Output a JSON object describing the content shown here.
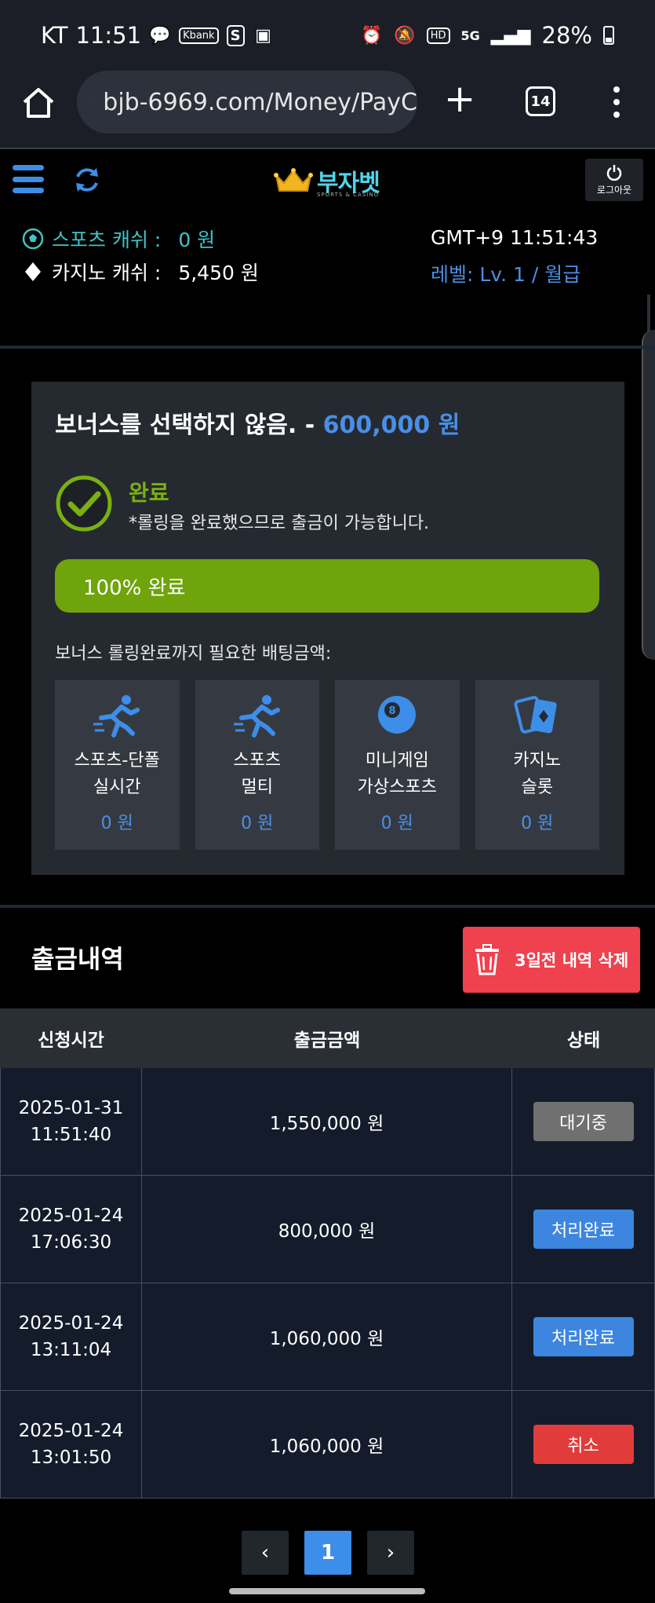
{
  "status_bar": {
    "carrier": "KT",
    "time": "11:51",
    "battery": "28%",
    "icons": [
      "chat-icon",
      "kbank-icon",
      "s-icon",
      "gallery-icon",
      "alarm-icon",
      "mute-icon",
      "hd-icon",
      "5g-icon",
      "signal-icon",
      "battery-icon"
    ],
    "kbank_label": "Kbank",
    "hd_label": "HD",
    "fiveg_label": "5G"
  },
  "browser": {
    "url": "bjb-6969.com/Money/PayC",
    "tab_count": "14"
  },
  "header": {
    "brand": "부자벳",
    "brand_sub": "SPORTS & CASINO",
    "logout_label": "로그아웃"
  },
  "account": {
    "sports_label": "스포츠 캐쉬 :",
    "sports_value": "0 원",
    "casino_label": "카지노 캐쉬 :",
    "casino_value": "5,450 원",
    "clock": "GMT+9 11:51:43",
    "level": "레벨: Lv. 1 / 월급"
  },
  "bonus": {
    "title": "보너스를 선택하지 않음. - ",
    "amount": "600,000 원",
    "status": "완료",
    "status_desc": "*롤링을 완료했으므로 출금이 가능합니다.",
    "progress_text": "100% 완료",
    "progress": 1.0,
    "need_label": "보너스 롤링완료까지 필요한 배팅금액:",
    "cards": [
      {
        "line1": "스포츠-단폴",
        "line2": "실시간",
        "value": "0 원",
        "icon": "runner-icon"
      },
      {
        "line1": "스포츠",
        "line2": "멀티",
        "value": "0 원",
        "icon": "runner-icon"
      },
      {
        "line1": "미니게임",
        "line2": "가상스포츠",
        "value": "0 원",
        "icon": "billiard-ball-icon"
      },
      {
        "line1": "카지노",
        "line2": "슬롯",
        "value": "0 원",
        "icon": "cards-icon"
      }
    ]
  },
  "withdraw": {
    "title": "출금내역",
    "delete_label": "3일전 내역 삭제",
    "columns": [
      "신청시간",
      "출금금액",
      "상태"
    ],
    "rows": [
      {
        "date": "2025-01-31",
        "time": "11:51:40",
        "amount": "1,550,000 원",
        "status": "대기중",
        "color": "#707070"
      },
      {
        "date": "2025-01-24",
        "time": "17:06:30",
        "amount": "800,000 원",
        "status": "처리완료",
        "color": "#3d86e0"
      },
      {
        "date": "2025-01-24",
        "time": "13:11:04",
        "amount": "1,060,000 원",
        "status": "처리완료",
        "color": "#3d86e0"
      },
      {
        "date": "2025-01-24",
        "time": "13:01:50",
        "amount": "1,060,000 원",
        "status": "취소",
        "color": "#e23b3b"
      }
    ]
  },
  "pagination": {
    "prev": "‹",
    "current": "1",
    "next": "›"
  },
  "colors": {
    "accent": "#3d8ee8",
    "success": "#6fa40c",
    "danger": "#f0414e"
  }
}
